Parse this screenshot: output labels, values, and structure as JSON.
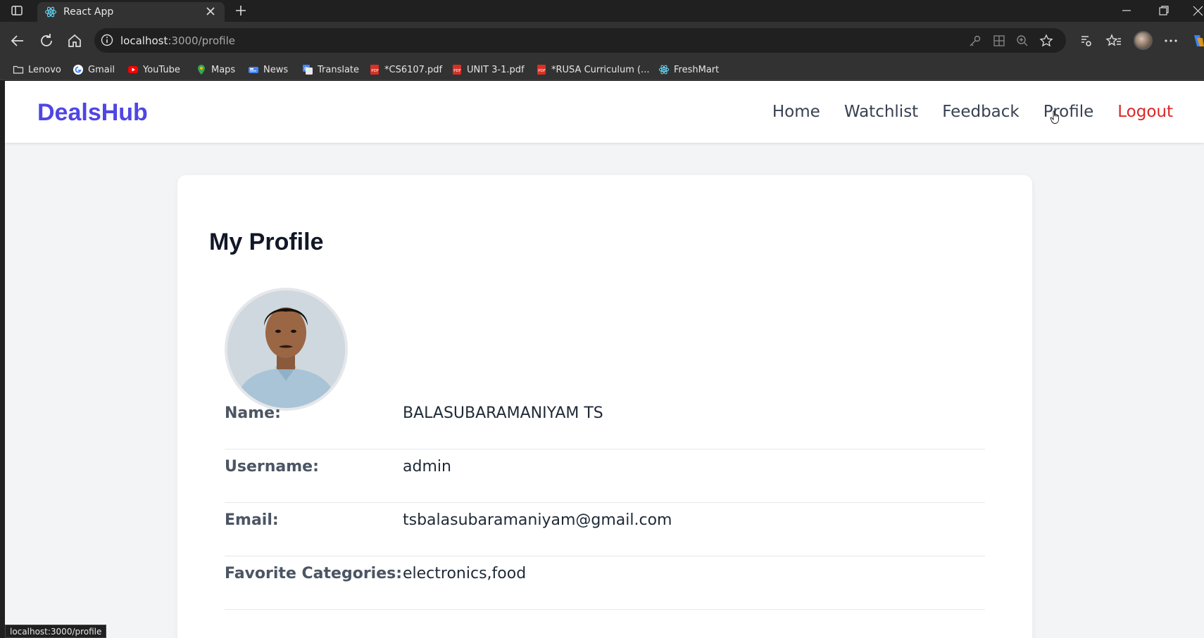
{
  "browser": {
    "tab_title": "React App",
    "url_host": "localhost",
    "url_path": ":3000/profile",
    "bookmarks": [
      {
        "label": "Lenovo",
        "icon": "folder-icon"
      },
      {
        "label": "Gmail",
        "icon": "google-icon"
      },
      {
        "label": "YouTube",
        "icon": "youtube-icon"
      },
      {
        "label": "Maps",
        "icon": "maps-icon"
      },
      {
        "label": "News",
        "icon": "news-icon"
      },
      {
        "label": "Translate",
        "icon": "translate-icon"
      },
      {
        "label": "*CS6107.pdf",
        "icon": "pdf-icon"
      },
      {
        "label": "UNIT 3-1.pdf",
        "icon": "pdf-icon"
      },
      {
        "label": "*RUSA Curriculum (...",
        "icon": "pdf-icon"
      },
      {
        "label": "FreshMart",
        "icon": "react-icon"
      }
    ],
    "status_url": "localhost:3000/profile"
  },
  "app": {
    "brand": "DealsHub",
    "nav": {
      "home": "Home",
      "watchlist": "Watchlist",
      "feedback": "Feedback",
      "profile": "Profile",
      "logout": "Logout"
    },
    "colors": {
      "brand": "#4f46e5",
      "logout": "#dc2626"
    }
  },
  "profile": {
    "heading": "My Profile",
    "fields": [
      {
        "label": "Name:",
        "value": "BALASUBARAMANIYAM TS"
      },
      {
        "label": "Username:",
        "value": "admin"
      },
      {
        "label": "Email:",
        "value": "tsbalasubaramaniyam@gmail.com"
      },
      {
        "label": "Favorite Categories:",
        "value": "electronics,food"
      }
    ]
  }
}
